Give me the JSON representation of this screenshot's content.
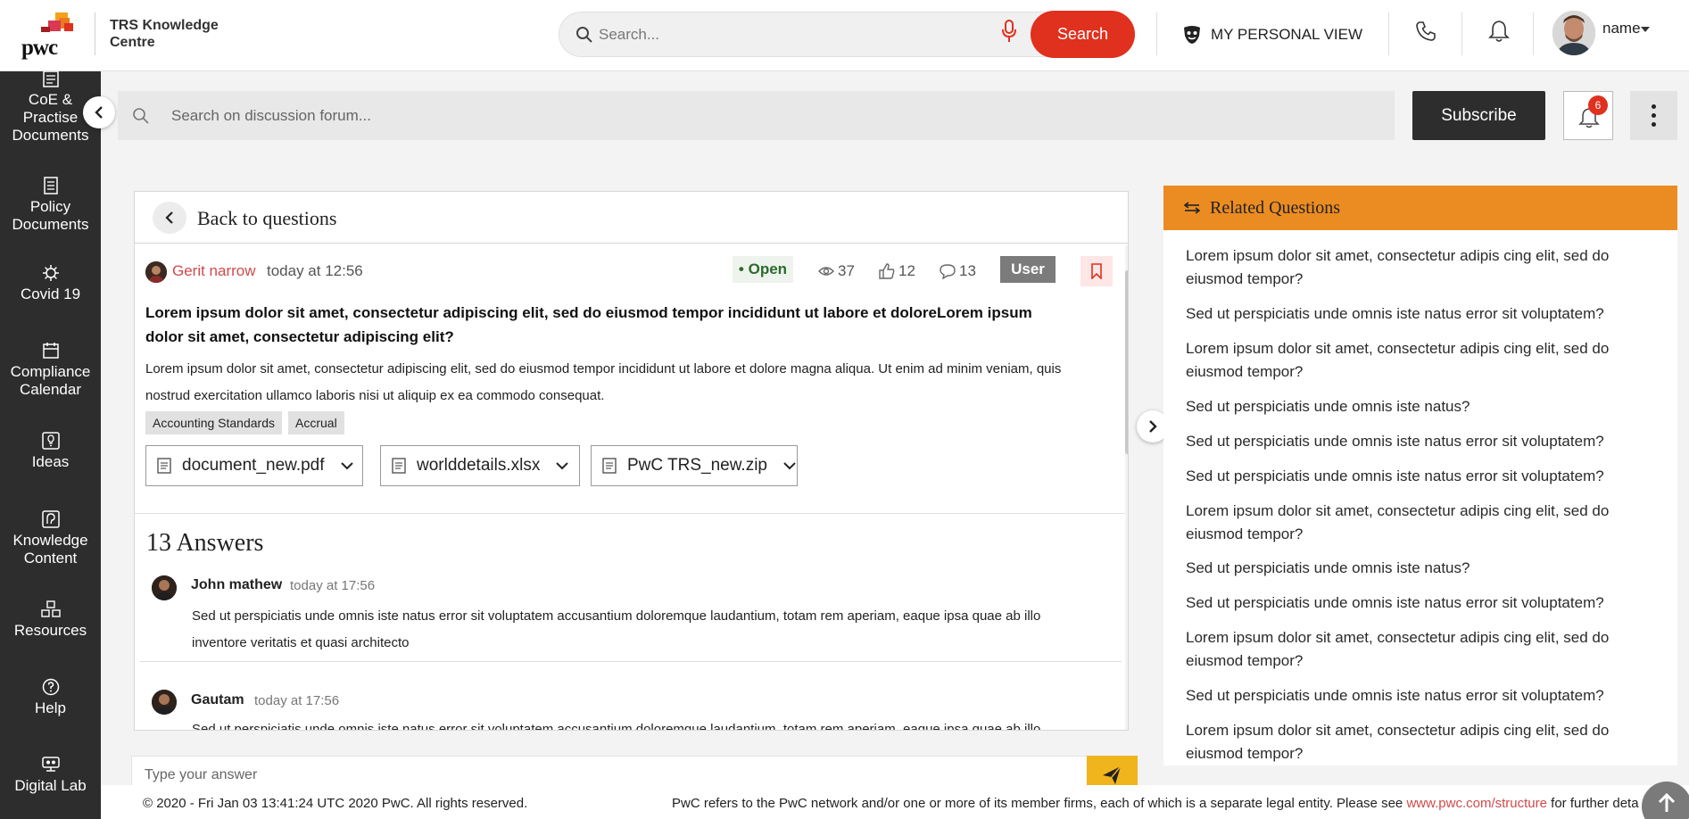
{
  "header": {
    "logo_text": "pwc",
    "brand_line1": "TRS Knowledge",
    "brand_line2": "Centre",
    "search_placeholder": "Search...",
    "search_button": "Search",
    "personal_view": "MY PERSONAL VIEW",
    "user_name": "name"
  },
  "sidebar": {
    "items": [
      {
        "label": "CoE & Practise Documents",
        "icon": "document-list-icon"
      },
      {
        "label": "Policy Documents",
        "icon": "policy-document-icon"
      },
      {
        "label": "Covid 19",
        "icon": "virus-icon"
      },
      {
        "label": "Compliance Calendar",
        "icon": "calendar-icon"
      },
      {
        "label": "Ideas",
        "icon": "idea-icon"
      },
      {
        "label": "Knowledge Content",
        "icon": "knowledge-icon"
      },
      {
        "label": "Resources",
        "icon": "resources-icon"
      },
      {
        "label": "Help",
        "icon": "help-icon"
      },
      {
        "label": "Digital Lab",
        "icon": "lab-icon"
      }
    ]
  },
  "forum": {
    "search_placeholder": "Search on discussion forum...",
    "subscribe": "Subscribe",
    "notification_count": "6"
  },
  "question": {
    "back_label": "Back to questions",
    "author": "Gerit narrow",
    "time": "today at 12:56",
    "status": "Open",
    "views": "37",
    "likes": "12",
    "comments": "13",
    "role_badge": "User",
    "title": "Lorem ipsum dolor sit amet, consectetur adipiscing elit, sed do eiusmod tempor incididunt ut labore et doloreLorem ipsum dolor sit amet, consectetur adipiscing elit?",
    "body": "Lorem ipsum dolor sit amet, consectetur adipiscing elit, sed do eiusmod tempor incididunt ut labore et dolore magna aliqua. Ut enim ad minim veniam, quis nostrud exercitation ullamco laboris nisi ut aliquip ex ea commodo consequat.",
    "tags": [
      "Accounting Standards",
      "Accrual"
    ],
    "attachments": [
      "document_new.pdf",
      "worlddetails.xlsx",
      "PwC TRS_new.zip"
    ]
  },
  "answers": {
    "heading": "13 Answers",
    "items": [
      {
        "name": "John mathew",
        "time": "today at 17:56",
        "text": "Sed ut perspiciatis unde omnis iste natus error sit voluptatem accusantium doloremque laudantium, totam rem aperiam, eaque ipsa quae ab illo inventore veritatis et quasi architecto"
      },
      {
        "name": "Gautam",
        "time": "today at 17:56",
        "text": "Sed ut perspiciatis unde omnis iste natus error sit voluptatem accusantium doloremque laudantium, totam rem aperiam, eaque ipsa quae ab illo inventore veritatis et quasi architecto"
      }
    ],
    "input_placeholder": "Type your answer"
  },
  "related": {
    "heading": "Related Questions",
    "items": [
      "Lorem ipsum dolor sit amet, consectetur adipis cing elit, sed do eiusmod tempor?",
      "Sed ut perspiciatis unde omnis iste natus error sit voluptatem?",
      "Lorem ipsum dolor sit amet, consectetur adipis cing elit, sed do eiusmod tempor?",
      "Sed ut perspiciatis unde omnis iste natus?",
      "Sed ut perspiciatis unde omnis iste natus error sit voluptatem?",
      "Sed ut perspiciatis unde omnis iste natus error sit voluptatem?",
      "Lorem ipsum dolor sit amet, consectetur adipis cing elit, sed do eiusmod tempor?",
      "Sed ut perspiciatis unde omnis iste natus?",
      "Sed ut perspiciatis unde omnis iste natus error sit voluptatem?",
      "Lorem ipsum dolor sit amet, consectetur adipis cing elit, sed do eiusmod tempor?",
      "Sed ut perspiciatis unde omnis iste natus error sit voluptatem?",
      "Lorem ipsum dolor sit amet, consectetur adipis cing elit, sed do eiusmod tempor?"
    ]
  },
  "footer": {
    "copyright": "© 2020 - Fri Jan 03 13:41:24 UTC 2020 PwC. All rights reserved.",
    "legal_prefix": "PwC refers to the PwC network and/or one or more of its member firms, each of which is a separate legal entity. Please see",
    "legal_link": "www.pwc.com/structure",
    "legal_suffix": "for further deta"
  },
  "colors": {
    "brand_red": "#e0301e",
    "brand_orange": "#eb8c22",
    "sidebar_bg": "#2d2d2d",
    "send_yellow": "#f0b41c"
  }
}
